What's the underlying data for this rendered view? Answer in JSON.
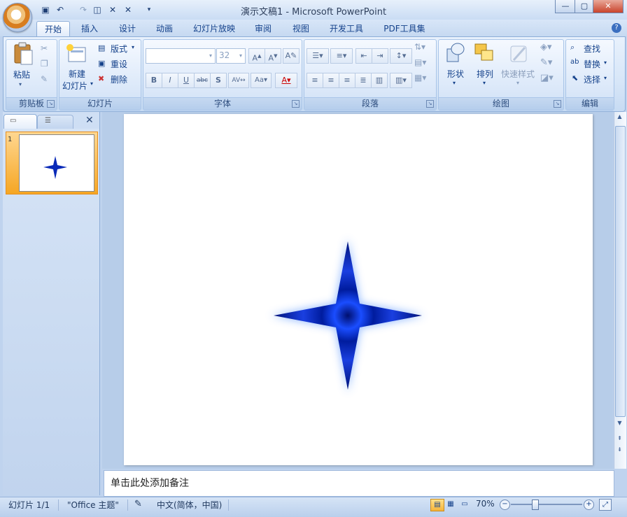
{
  "window": {
    "title": "演示文稿1 - Microsoft PowerPoint"
  },
  "tabs": [
    {
      "label": "开始",
      "active": true
    },
    {
      "label": "插入"
    },
    {
      "label": "设计"
    },
    {
      "label": "动画"
    },
    {
      "label": "幻灯片放映"
    },
    {
      "label": "审阅"
    },
    {
      "label": "视图"
    },
    {
      "label": "开发工具"
    },
    {
      "label": "PDF工具集"
    }
  ],
  "ribbon": {
    "clipboard": {
      "label": "剪贴板",
      "paste": "粘贴"
    },
    "slides": {
      "label": "幻灯片",
      "new_slide_l1": "新建",
      "new_slide_l2": "幻灯片",
      "layout": "版式",
      "reset": "重设",
      "delete": "删除"
    },
    "font": {
      "label": "字体",
      "font_size": "32"
    },
    "paragraph": {
      "label": "段落"
    },
    "drawing": {
      "label": "绘图",
      "shapes": "形状",
      "arrange": "排列",
      "quick_styles": "快速样式"
    },
    "editing": {
      "label": "编辑",
      "find": "查找",
      "replace": "替换",
      "select": "选择"
    }
  },
  "slides_panel": {
    "thumb_number": "1"
  },
  "notes": {
    "placeholder": "单击此处添加备注"
  },
  "status": {
    "slide": "幻灯片 1/1",
    "theme": "\"Office 主题\"",
    "language": "中文(简体，中国)",
    "zoom": "70%"
  },
  "colors": {
    "ribbon_text": "#15428b",
    "star_dark": "#001c9e",
    "star_light": "#1a4dff",
    "glow": "#8fb7ff",
    "selected_thumb": "#f5a623"
  }
}
